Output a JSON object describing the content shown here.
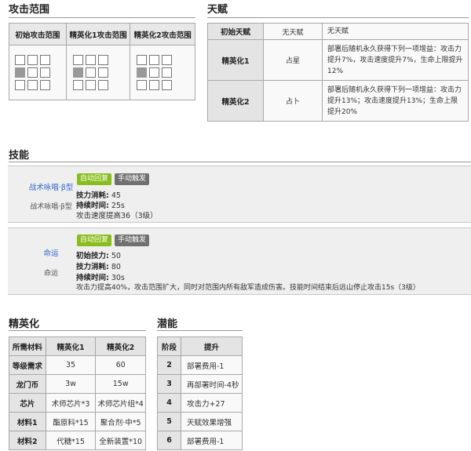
{
  "range": {
    "title": "攻击范围",
    "headers": [
      "初始攻击范围",
      "精英化1攻击范围",
      "精英化2攻击范围"
    ]
  },
  "talent": {
    "title": "天赋",
    "rows": [
      {
        "label": "初始天赋",
        "name": "无天赋",
        "desc": "无天赋"
      },
      {
        "label": "精英化1",
        "name": "占星",
        "desc": "部署后随机永久获得下列一项增益：攻击力提升7%，攻击速度提升7%，生命上限提升12%"
      },
      {
        "label": "精英化2",
        "name": "占卜",
        "desc": "部署后随机永久获得下列一项增益：攻击力提升13%；攻击速度提升13%；生命上限提升20%"
      }
    ]
  },
  "skills": {
    "title": "技能",
    "items": [
      {
        "name": "战术咏唱·β型",
        "subname": "战术咏唱·β型",
        "tag_auto": "自动回复",
        "tag_manual": "手动触发",
        "stats": [
          {
            "label": "技力消耗:",
            "value": " 45"
          },
          {
            "label": "持续时间:",
            "value": " 25s"
          }
        ],
        "desc": "攻击速度提高36（3级）"
      },
      {
        "name": "命运",
        "subname": "命运",
        "tag_auto": "自动回复",
        "tag_manual": "手动触发",
        "stats": [
          {
            "label": "初始技力:",
            "value": " 50"
          },
          {
            "label": "技力消耗:",
            "value": " 80"
          },
          {
            "label": "持续时间:",
            "value": " 30s"
          }
        ],
        "desc": "攻击力提高40%，攻击范围扩大，同时对范围内所有敌军造成伤害。技能时间结束后远山停止攻击15s（3级）"
      }
    ]
  },
  "elite": {
    "title": "精英化",
    "headers": [
      "所需材料",
      "精英化1",
      "精英化2"
    ],
    "rows": [
      [
        "等级需求",
        "35",
        "60"
      ],
      [
        "龙门币",
        "3w",
        "15w"
      ],
      [
        "芯片",
        "术师芯片*3",
        "术师芯片组*4"
      ],
      [
        "材料1",
        "酯原料*15",
        "聚合剂·中*5"
      ],
      [
        "材料2",
        "代糖*15",
        "全新装置*10"
      ]
    ]
  },
  "potential": {
    "title": "潜能",
    "headers": [
      "阶段",
      "提升"
    ],
    "rows": [
      [
        "2",
        "部署费用-1"
      ],
      [
        "3",
        "再部署时间-4秒"
      ],
      [
        "4",
        "攻击力+27"
      ],
      [
        "5",
        "天赋效果增强"
      ],
      [
        "6",
        "部署费用-1"
      ]
    ]
  }
}
